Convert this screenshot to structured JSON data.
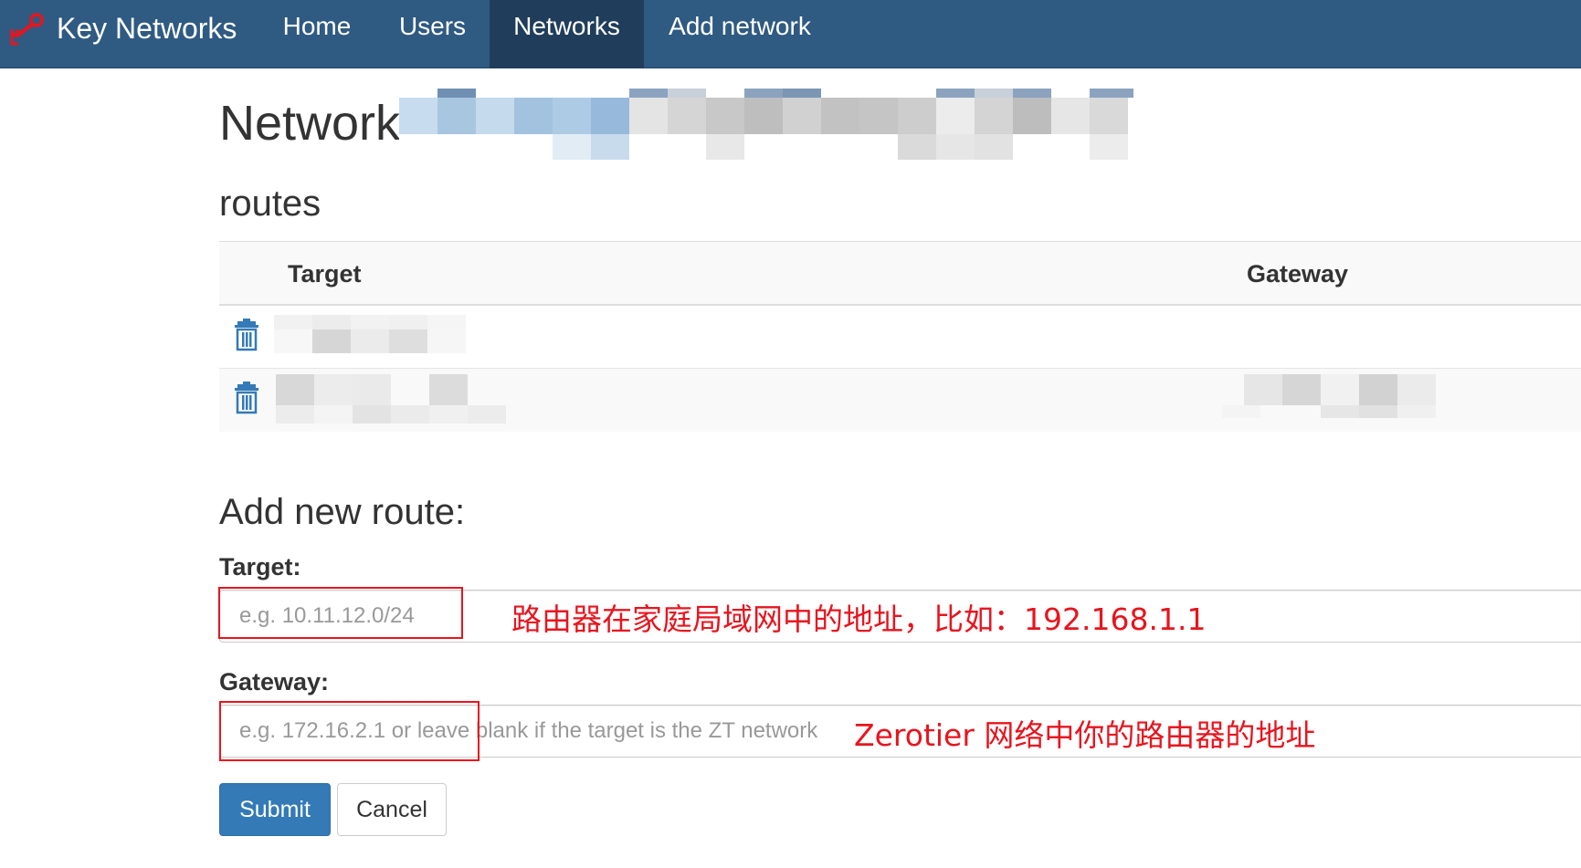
{
  "navbar": {
    "brand": "Key Networks",
    "items": [
      {
        "label": "Home",
        "active": false
      },
      {
        "label": "Users",
        "active": false
      },
      {
        "label": "Networks",
        "active": true
      },
      {
        "label": "Add network",
        "active": false
      }
    ],
    "background": "#2f5a82",
    "active_background": "#203e5b"
  },
  "page": {
    "title": "Network",
    "title_suffix_redacted": true,
    "routes_heading": "routes"
  },
  "routes_table": {
    "columns": [
      "Target",
      "Gateway"
    ],
    "rows": [
      {
        "delete_icon": "trash-icon",
        "target_redacted": true,
        "gateway_redacted": false
      },
      {
        "delete_icon": "trash-icon",
        "target_redacted": true,
        "gateway_redacted": true
      }
    ]
  },
  "form": {
    "heading": "Add new route:",
    "target_label": "Target:",
    "target_placeholder": "e.g. 10.11.12.0/24",
    "target_value": "",
    "gateway_label": "Gateway:",
    "gateway_placeholder": "e.g. 172.16.2.1 or leave blank if the target is the ZT network",
    "gateway_value": "",
    "submit_label": "Submit",
    "cancel_label": "Cancel"
  },
  "annotations": {
    "target_note": "路由器在家庭局域网中的地址，比如：192.168.1.1",
    "gateway_note": "Zerotier 网络中你的路由器的地址",
    "color": "#e8141e"
  },
  "colors": {
    "primary": "#337ab7",
    "icon_blue": "#337ab7"
  }
}
